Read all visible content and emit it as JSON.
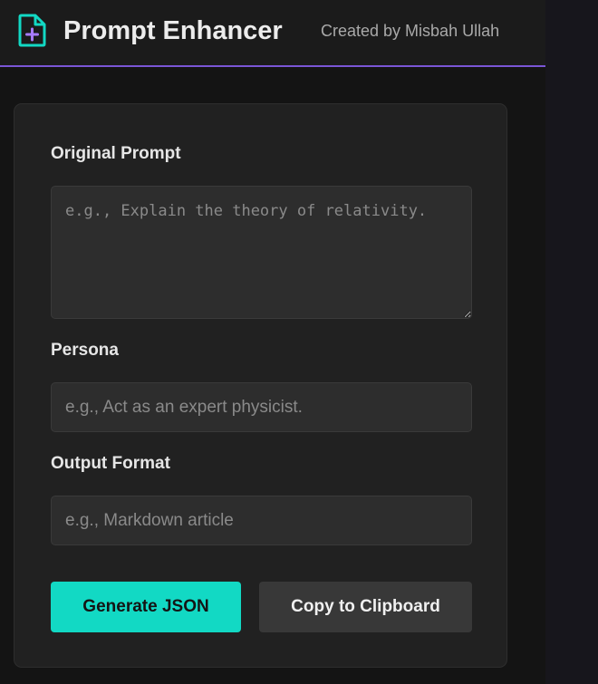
{
  "header": {
    "title": "Prompt Enhancer",
    "credit": "Created by Misbah Ullah",
    "icon": "file-plus-icon",
    "accent_color": "#7a55d6",
    "icon_color": "#12d9c4",
    "icon_plus_color": "#a77bff"
  },
  "form": {
    "original_prompt": {
      "label": "Original Prompt",
      "placeholder": "e.g., Explain the theory of relativity.",
      "value": ""
    },
    "persona": {
      "label": "Persona",
      "placeholder": "e.g., Act as an expert physicist.",
      "value": ""
    },
    "output_format": {
      "label": "Output Format",
      "placeholder": "e.g., Markdown article",
      "value": ""
    }
  },
  "actions": {
    "generate_label": "Generate JSON",
    "copy_label": "Copy to Clipboard",
    "primary_color": "#12d9c4"
  }
}
